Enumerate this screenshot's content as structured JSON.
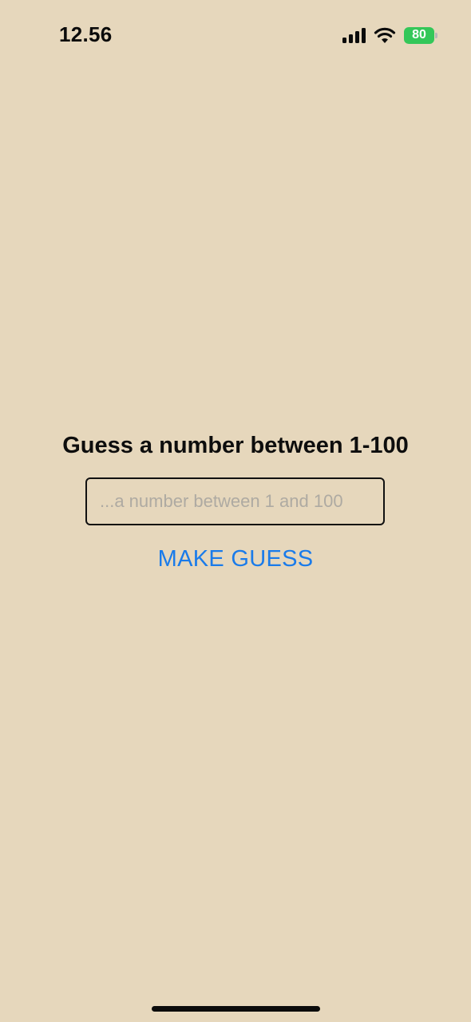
{
  "status_bar": {
    "time": "12.56",
    "battery_level": "80",
    "battery_color": "#34c759",
    "icons": [
      "signal-icon",
      "wifi-icon",
      "battery-icon"
    ]
  },
  "game": {
    "title": "Guess a number between 1-100",
    "input_value": "",
    "input_placeholder": "...a number between 1 and 100",
    "button_label": "MAKE GUESS",
    "accent_color": "#1a7bea",
    "background_color": "#e6d7bc"
  }
}
